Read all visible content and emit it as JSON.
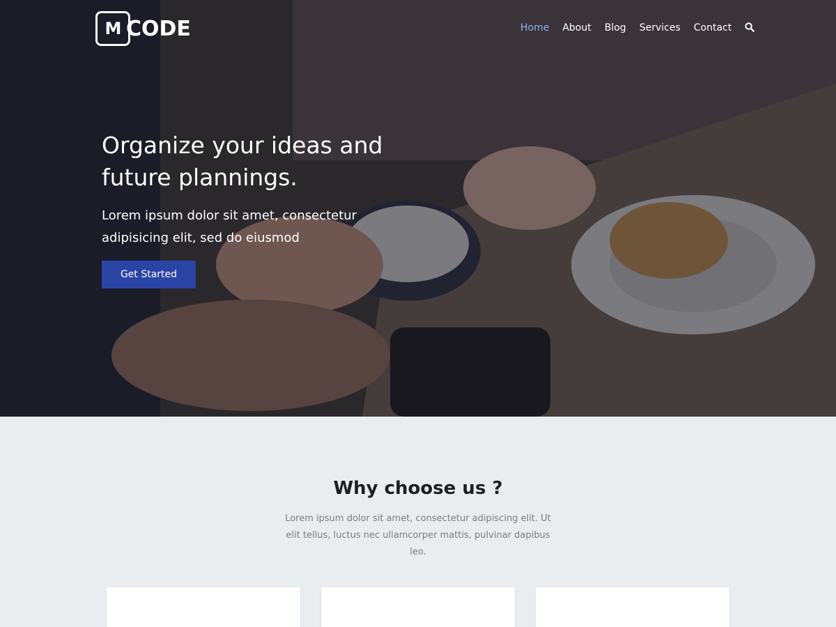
{
  "brand": {
    "logo_mark": "M",
    "logo_text": "CODE"
  },
  "nav": {
    "items": [
      "Home",
      "About",
      "Blog",
      "Services",
      "Contact"
    ],
    "active": "Home",
    "search_icon": "search-icon"
  },
  "hero": {
    "title": "Organize your ideas and future plannings.",
    "subtitle": "Lorem ipsum dolor sit amet, consectetur adipisicing elit, sed do eiusmod",
    "cta_label": "Get Started"
  },
  "why": {
    "title": "Why choose us ?",
    "text": "Lorem ipsum dolor sit amet, consectetur adipiscing elit. Ut elit tellus, luctus nec ullamcorper mattis, pulvinar dapibus leo."
  },
  "colors": {
    "accent": "#2a44a6",
    "nav_active": "#8fb3ea",
    "section_bg": "#eaedf0"
  }
}
